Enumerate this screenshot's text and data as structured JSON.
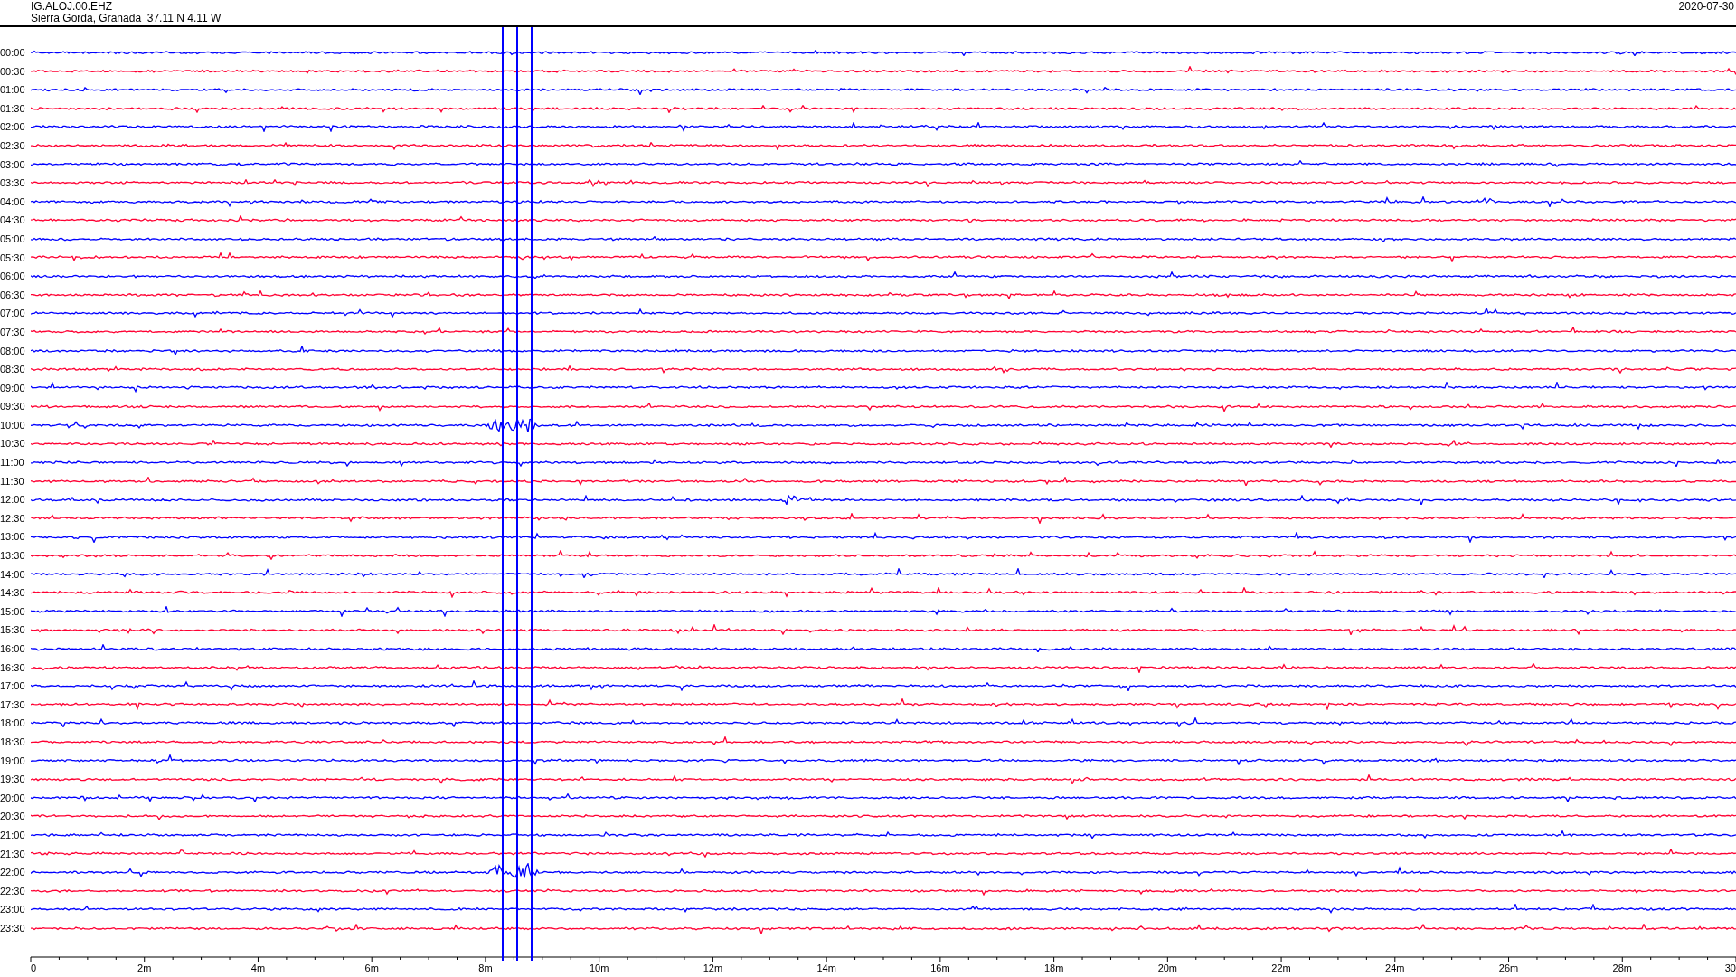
{
  "header": {
    "station": "IG.ALOJ.00.EHZ",
    "location": "Sierra Gorda, Granada  37.11 N 4.11 W",
    "date": "2020-07-30"
  },
  "traces": [
    {
      "label": "00:00",
      "color": "#0000ff"
    },
    {
      "label": "00:30",
      "color": "#ff0033"
    },
    {
      "label": "01:00",
      "color": "#0000ff"
    },
    {
      "label": "01:30",
      "color": "#ff0033"
    },
    {
      "label": "02:00",
      "color": "#0000ff"
    },
    {
      "label": "02:30",
      "color": "#ff0033"
    },
    {
      "label": "03:00",
      "color": "#0000ff"
    },
    {
      "label": "03:30",
      "color": "#ff0033"
    },
    {
      "label": "04:00",
      "color": "#0000ff"
    },
    {
      "label": "04:30",
      "color": "#ff0033"
    },
    {
      "label": "05:00",
      "color": "#0000ff"
    },
    {
      "label": "05:30",
      "color": "#ff0033"
    },
    {
      "label": "06:00",
      "color": "#0000ff"
    },
    {
      "label": "06:30",
      "color": "#ff0033"
    },
    {
      "label": "07:00",
      "color": "#0000ff"
    },
    {
      "label": "07:30",
      "color": "#ff0033"
    },
    {
      "label": "08:00",
      "color": "#0000ff"
    },
    {
      "label": "08:30",
      "color": "#ff0033"
    },
    {
      "label": "09:00",
      "color": "#0000ff"
    },
    {
      "label": "09:30",
      "color": "#ff0033"
    },
    {
      "label": "10:00",
      "color": "#0000ff"
    },
    {
      "label": "10:30",
      "color": "#ff0033"
    },
    {
      "label": "11:00",
      "color": "#0000ff"
    },
    {
      "label": "11:30",
      "color": "#ff0033"
    },
    {
      "label": "12:00",
      "color": "#0000ff"
    },
    {
      "label": "12:30",
      "color": "#ff0033"
    },
    {
      "label": "13:00",
      "color": "#0000ff"
    },
    {
      "label": "13:30",
      "color": "#ff0033"
    },
    {
      "label": "14:00",
      "color": "#0000ff"
    },
    {
      "label": "14:30",
      "color": "#ff0033"
    },
    {
      "label": "15:00",
      "color": "#0000ff"
    },
    {
      "label": "15:30",
      "color": "#ff0033"
    },
    {
      "label": "16:00",
      "color": "#0000ff"
    },
    {
      "label": "16:30",
      "color": "#ff0033"
    },
    {
      "label": "17:00",
      "color": "#0000ff"
    },
    {
      "label": "17:30",
      "color": "#ff0033"
    },
    {
      "label": "18:00",
      "color": "#0000ff"
    },
    {
      "label": "18:30",
      "color": "#ff0033"
    },
    {
      "label": "19:00",
      "color": "#0000ff"
    },
    {
      "label": "19:30",
      "color": "#ff0033"
    },
    {
      "label": "20:00",
      "color": "#0000ff"
    },
    {
      "label": "20:30",
      "color": "#ff0033"
    },
    {
      "label": "21:00",
      "color": "#0000ff"
    },
    {
      "label": "21:30",
      "color": "#ff0033"
    },
    {
      "label": "22:00",
      "color": "#0000ff"
    },
    {
      "label": "22:30",
      "color": "#ff0033"
    },
    {
      "label": "23:00",
      "color": "#0000ff"
    },
    {
      "label": "23:30",
      "color": "#ff0033"
    }
  ],
  "x_axis": {
    "labels": [
      "0",
      "2m",
      "4m",
      "6m",
      "8m",
      "10m",
      "12m",
      "14m",
      "16m",
      "18m",
      "20m",
      "22m",
      "24m",
      "26m",
      "28m",
      "30"
    ]
  }
}
